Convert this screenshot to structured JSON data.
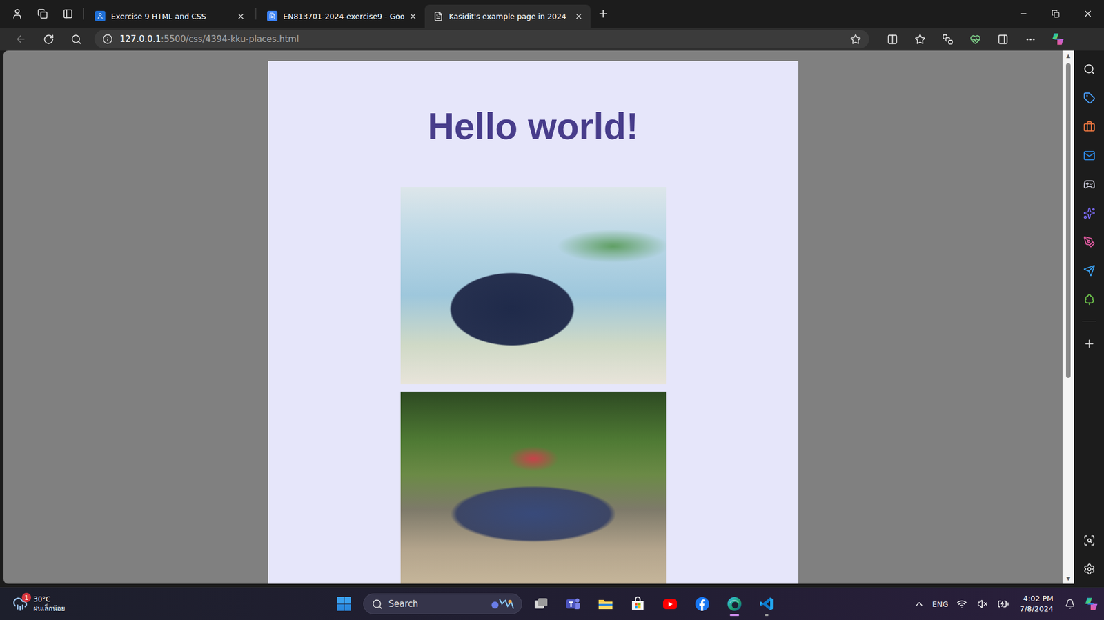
{
  "tabs": [
    {
      "label": "Exercise 9 HTML and CSS",
      "selected": false,
      "kind": "classroom"
    },
    {
      "label": "EN813701-2024-exercise9 - Goo",
      "selected": false,
      "kind": "docs"
    },
    {
      "label": "Kasidit's example page in 2024",
      "selected": true,
      "kind": "page"
    }
  ],
  "address": {
    "host": "127.0.0.1",
    "path": ":5500/css/4394-kku-places.html"
  },
  "page": {
    "heading": "Hello world!"
  },
  "scrollbar": {
    "level": 0.62
  },
  "taskbar": {
    "weather": {
      "temperature": "30°C",
      "condition": "ฝนเล็กน้อย",
      "badge": "1"
    },
    "search": {
      "placeholder": "Search"
    },
    "apps": [
      {
        "kind": "taskview",
        "running": false,
        "active": false
      },
      {
        "kind": "teams",
        "running": false,
        "active": false
      },
      {
        "kind": "explorer",
        "running": false,
        "active": false
      },
      {
        "kind": "store",
        "running": false,
        "active": false
      },
      {
        "kind": "youtube",
        "running": false,
        "active": false
      },
      {
        "kind": "facebook",
        "running": false,
        "active": false
      },
      {
        "kind": "edge",
        "running": true,
        "active": true
      },
      {
        "kind": "vscode",
        "running": true,
        "active": false
      }
    ],
    "language": "ENG",
    "time": "4:02 PM",
    "date": "7/8/2024"
  }
}
